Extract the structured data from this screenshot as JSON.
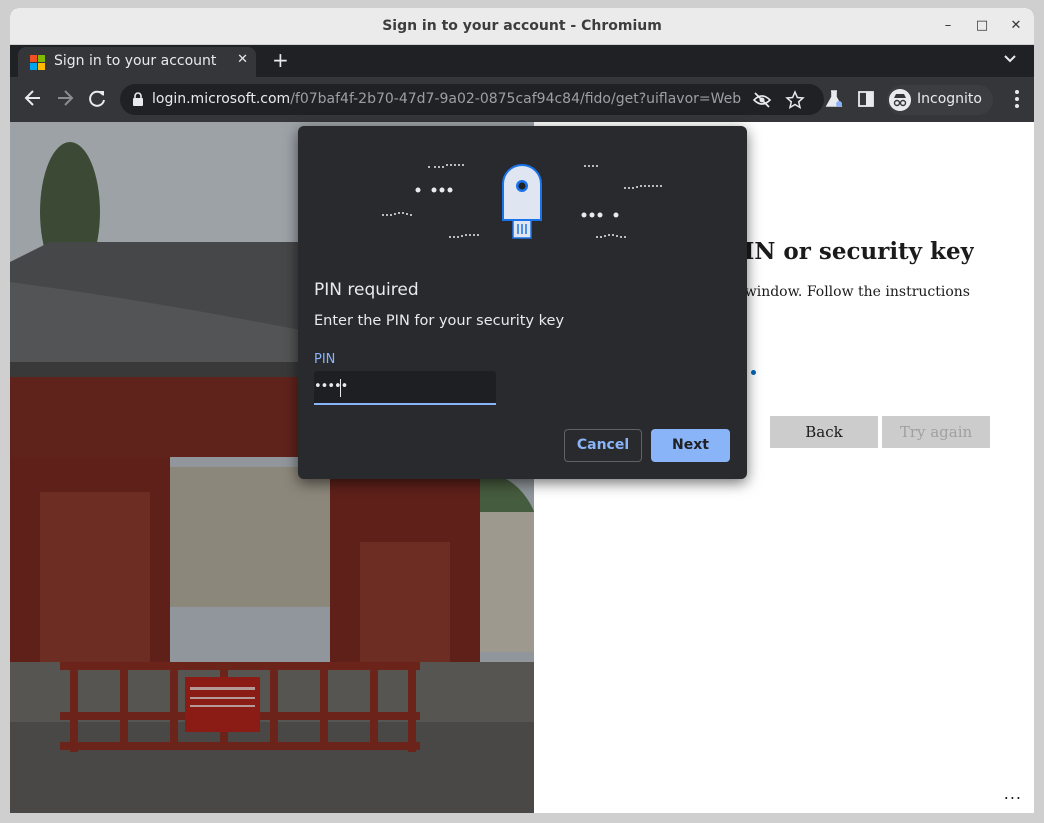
{
  "window": {
    "title": "Sign in to your account - Chromium"
  },
  "tab": {
    "title": "Sign in to your account"
  },
  "omnibox": {
    "domain": "login.microsoft.com",
    "path": "/f07baf4f-2b70-47d7-9a02-0875caf94c84/fido/get?uiflavor=Web"
  },
  "profile": {
    "label": "Incognito"
  },
  "page": {
    "heading": "t, PIN or security key",
    "body": "urity window. Follow the instructions",
    "back_label": "Back",
    "try_again_label": "Try again",
    "more_label": "..."
  },
  "dialog": {
    "title": "PIN required",
    "subtitle": "Enter the PIN for your security key",
    "pin_label": "PIN",
    "pin_value": "•••••",
    "cancel_label": "Cancel",
    "next_label": "Next"
  },
  "colors": {
    "accent": "#8ab4f8",
    "dialog_bg": "#292a2d",
    "microsoft_blue": "#0067b8"
  },
  "icons": [
    "microsoft-logo",
    "close-icon",
    "plus-icon",
    "chevron-down-icon",
    "back-arrow-icon",
    "forward-arrow-icon",
    "reload-icon",
    "lock-icon",
    "eye-off-icon",
    "star-icon",
    "labs-flask-icon",
    "side-panel-icon",
    "incognito-icon",
    "kebab-menu-icon",
    "security-key-icon"
  ]
}
